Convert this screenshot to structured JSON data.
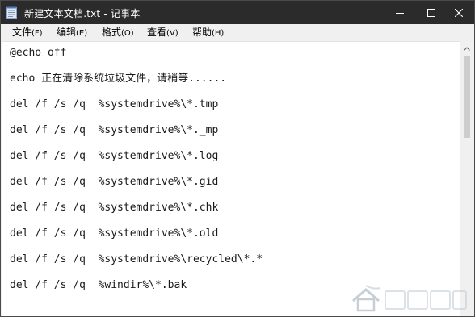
{
  "window": {
    "title": "新建文本文档.txt - 记事本"
  },
  "menu": {
    "items": [
      {
        "label": "文件",
        "accel": "(F)"
      },
      {
        "label": "编辑",
        "accel": "(E)"
      },
      {
        "label": "格式",
        "accel": "(O)"
      },
      {
        "label": "查看",
        "accel": "(V)"
      },
      {
        "label": "帮助",
        "accel": "(H)"
      }
    ]
  },
  "editor": {
    "lines": [
      "@echo off",
      "echo 正在清除系统垃圾文件，请稍等......",
      "del /f /s /q  %systemdrive%\\*.tmp",
      "del /f /s /q  %systemdrive%\\*._mp",
      "del /f /s /q  %systemdrive%\\*.log",
      "del /f /s /q  %systemdrive%\\*.gid",
      "del /f /s /q  %systemdrive%\\*.chk",
      "del /f /s /q  %systemdrive%\\*.old",
      "del /f /s /q  %systemdrive%\\recycled\\*.*",
      "del /f /s /q  %windir%\\*.bak"
    ]
  },
  "watermark": {
    "text": "系统之家"
  },
  "colors": {
    "titlebar": "#2b2b2b",
    "menubar": "#f0f0f0",
    "editor_bg": "#ffffff",
    "scroll_thumb": "#cdcdcd"
  },
  "icons": {
    "app": "notepad-icon",
    "minimize": "minimize-icon",
    "maximize": "maximize-icon",
    "close": "close-icon",
    "scroll_up": "chevron-up-icon",
    "watermark": "house-logo-icon"
  }
}
